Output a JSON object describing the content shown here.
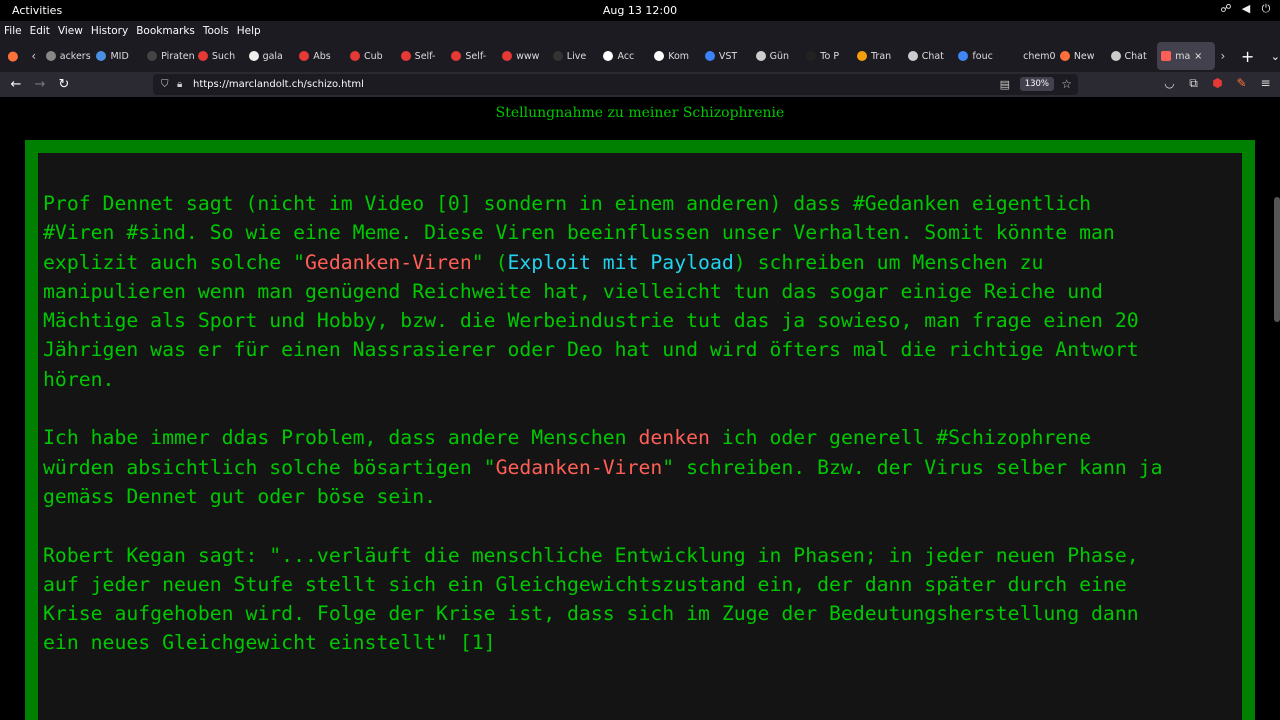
{
  "system": {
    "activities": "Activities",
    "clock": "Aug 13  12:00",
    "tray_icons": [
      "network-icon",
      "volume-icon",
      "power-icon"
    ]
  },
  "menu": [
    "File",
    "Edit",
    "View",
    "History",
    "Bookmarks",
    "Tools",
    "Help"
  ],
  "tabs": [
    {
      "label": "ackers",
      "color": "#888888"
    },
    {
      "label": "MID",
      "color": "#4a90e2"
    },
    {
      "label": "Piraten",
      "color": "#444444"
    },
    {
      "label": "Such",
      "color": "#e53935"
    },
    {
      "label": "gala",
      "color": "#eeeeee"
    },
    {
      "label": "Abs",
      "color": "#e53935"
    },
    {
      "label": "Cub",
      "color": "#e53935"
    },
    {
      "label": "Self-",
      "color": "#e53935"
    },
    {
      "label": "Self-",
      "color": "#e53935"
    },
    {
      "label": "www",
      "color": "#e53935"
    },
    {
      "label": "Live",
      "color": "#333333"
    },
    {
      "label": "Acc",
      "color": "#ffffff"
    },
    {
      "label": "Kom",
      "color": "#ffffff"
    },
    {
      "label": "VST",
      "color": "#3b82f6"
    },
    {
      "label": "Gün",
      "color": "#cccccc"
    },
    {
      "label": "To P",
      "color": "#222222"
    },
    {
      "label": "Tran",
      "color": "#f59e0b"
    },
    {
      "label": "Chat",
      "color": "#cccccc"
    },
    {
      "label": "fouc",
      "color": "#4285f4"
    },
    {
      "label": "chem02",
      "color": "#1c1b22"
    },
    {
      "label": "New",
      "color": "#ff7139"
    },
    {
      "label": "Chat",
      "color": "#cccccc"
    }
  ],
  "active_tab": {
    "label": "ma",
    "color": "#ff5f57"
  },
  "nav": {
    "url": "https://marclandolt.ch/schizo.html",
    "zoom": "130%"
  },
  "page": {
    "title": "Stellungnahme zu meiner Schizophrenie",
    "p1": {
      "a": "Prof Dennet sagt (nicht im Video [0] sondern in einem anderen) dass #Gedanken eigentlich #Viren #sind. So wie eine Meme. Diese Viren beeinflussen unser Verhalten. Somit könnte man explizit auch solche \"",
      "b": "Gedanken-Viren",
      "c": "\" (",
      "d": "Exploit mit Payload",
      "e": ") schreiben um Menschen zu manipulieren wenn man genügend Reichweite hat, vielleicht tun das sogar einige Reiche und Mächtige als Sport und Hobby, bzw. die Werbeindustrie tut das ja sowieso, man frage einen 20 Jährigen was er für einen Nassrasierer oder Deo hat und wird öfters mal die richtige Antwort hören."
    },
    "p2": {
      "a": "Ich habe immer ddas Problem, dass andere Menschen ",
      "b": "denken",
      "c": " ich oder generell #Schizophrene würden absichtlich solche bösartigen \"",
      "d": "Gedanken-Viren",
      "e": "\" schreiben. Bzw. der Virus selber kann ja gemäss Dennet gut oder böse sein."
    },
    "p3": "Robert Kegan sagt: \"...verläuft die menschliche Entwicklung in Phasen; in jeder neuen Phase, auf jeder neuen Stufe stellt sich ein Gleichgewichtszustand ein, der dann später durch eine Krise aufgehoben wird. Folge der Krise ist, dass sich im Zuge der Bedeutungsherstellung dann ein neues Gleichgewicht einstellt\" [1]"
  },
  "colors": {
    "text_green": "#00c800",
    "frame_green": "#008000",
    "highlight_red": "#ff5f57",
    "link_cyan": "#22d3ee",
    "panel_bg": "#141414"
  }
}
